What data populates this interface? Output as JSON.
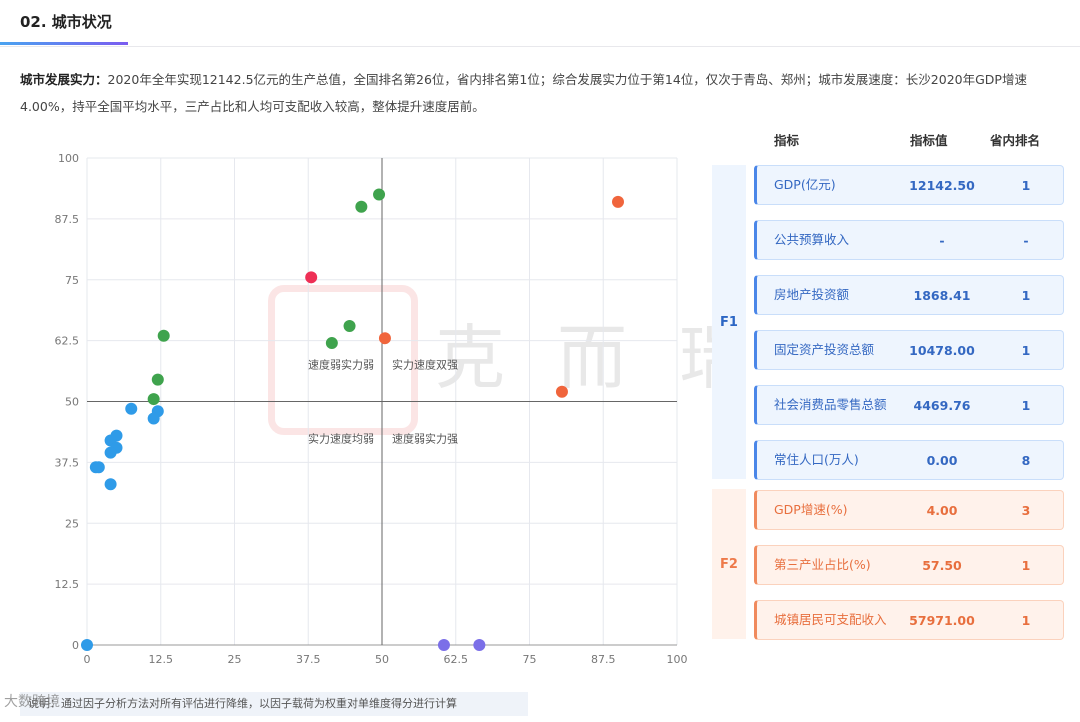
{
  "header": {
    "section_title": "02. 城市状况"
  },
  "summary": {
    "label": "城市发展实力：",
    "text": "2020年全年实现12142.5亿元的生产总值，全国排名第26位，省内排名第1位；综合发展实力位于第14位，仅次于青岛、郑州；城市发展速度：长沙2020年GDP增速4.00%，持平全国平均水平，三产占比和人均可支配收入较高，整体提升速度居前。"
  },
  "chart_data": {
    "type": "scatter",
    "xlim": [
      0,
      100
    ],
    "ylim": [
      0,
      100
    ],
    "x_ticks": [
      "0",
      "12.5",
      "25",
      "37.5",
      "50",
      "62.5",
      "75",
      "87.5",
      "100"
    ],
    "y_ticks": [
      "0",
      "12.5",
      "25",
      "37.5",
      "50",
      "62.5",
      "75",
      "87.5",
      "100"
    ],
    "crosshair": {
      "x": 50,
      "y": 50
    },
    "grid": true,
    "quadrant_labels": {
      "top_left": "速度弱实力弱",
      "top_right": "实力速度双强",
      "bottom_left": "实力速度均弱",
      "bottom_right": "速度弱实力强"
    },
    "series": [
      {
        "color": "#3fa34d",
        "points": [
          [
            49.5,
            92.5
          ],
          [
            46.5,
            90
          ],
          [
            44.5,
            65.5
          ],
          [
            41.5,
            62
          ],
          [
            13,
            63.5
          ],
          [
            12,
            54.5
          ],
          [
            11.3,
            50.5
          ]
        ]
      },
      {
        "color": "#ee2f55",
        "points": [
          [
            38,
            75.5
          ]
        ]
      },
      {
        "color": "#f0653c",
        "points": [
          [
            90,
            91
          ],
          [
            50.5,
            63
          ],
          [
            80.5,
            52
          ]
        ]
      },
      {
        "color": "#2f9be8",
        "points": [
          [
            7.5,
            48.5
          ],
          [
            12,
            48
          ],
          [
            11.3,
            46.5
          ],
          [
            5,
            43
          ],
          [
            4,
            42
          ],
          [
            5,
            40.5
          ],
          [
            4,
            39.5
          ],
          [
            1.5,
            36.5
          ],
          [
            2,
            36.5
          ],
          [
            4,
            33
          ],
          [
            0,
            0
          ]
        ]
      },
      {
        "color": "#7b6fe8",
        "points": [
          [
            60.5,
            0
          ],
          [
            66.5,
            0
          ]
        ]
      }
    ]
  },
  "table": {
    "headers": {
      "indicator": "指标",
      "value": "指标值",
      "rank": "省内排名"
    },
    "groups": [
      {
        "name": "F1",
        "rows": [
          {
            "name": "GDP(亿元)",
            "value": "12142.50",
            "rank": "1"
          },
          {
            "name": "公共预算收入",
            "value": "-",
            "rank": "-"
          },
          {
            "name": "房地产投资额",
            "value": "1868.41",
            "rank": "1"
          },
          {
            "name": "固定资产投资总额",
            "value": "10478.00",
            "rank": "1"
          },
          {
            "name": "社会消费品零售总额",
            "value": "4469.76",
            "rank": "1"
          },
          {
            "name": "常住人口(万人)",
            "value": "0.00",
            "rank": "8"
          }
        ]
      },
      {
        "name": "F2",
        "rows": [
          {
            "name": "GDP增速(%)",
            "value": "4.00",
            "rank": "3"
          },
          {
            "name": "第三产业占比(%)",
            "value": "57.50",
            "rank": "1"
          },
          {
            "name": "城镇居民可支配收入",
            "value": "57971.00",
            "rank": "1"
          }
        ]
      }
    ]
  },
  "watermark": {
    "text": "克而瑞"
  },
  "footer": {
    "note": "说明：通过因子分析方法对所有评估进行降维，以因子载荷为权重对单维度得分进行计算",
    "logo_text": "大数跨境"
  }
}
